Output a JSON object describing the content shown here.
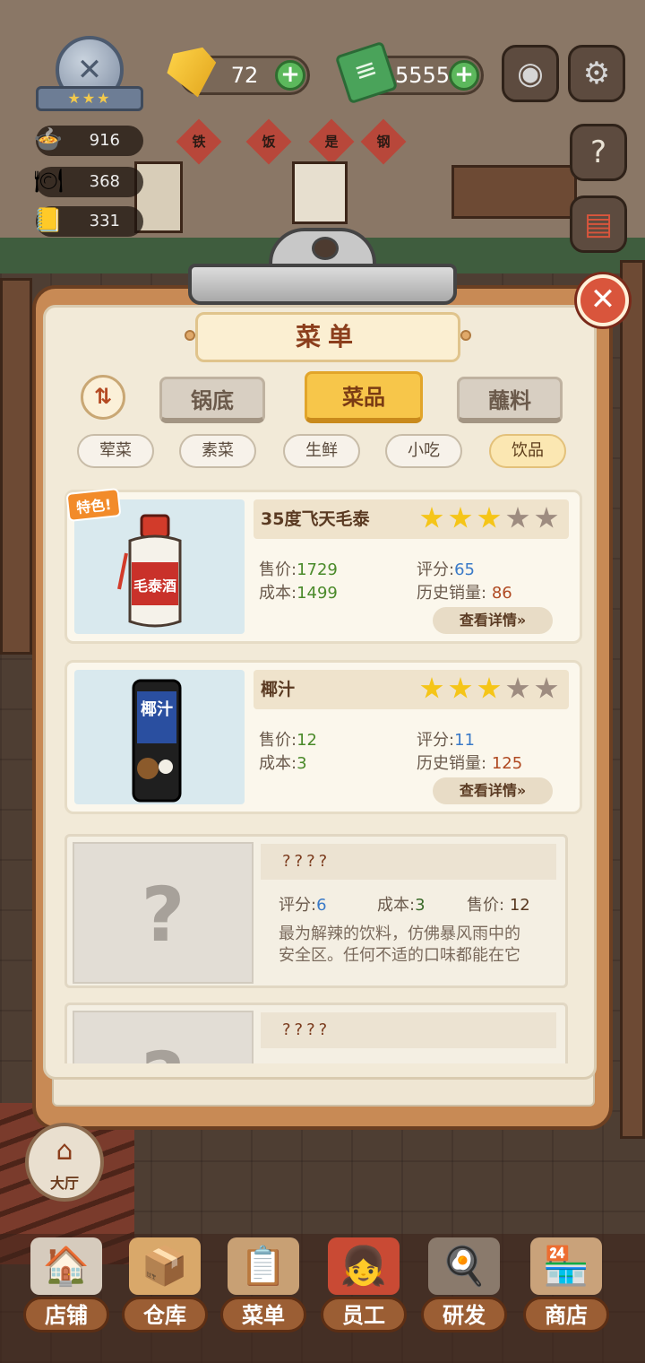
{
  "hud": {
    "rank_stars": "★★★",
    "gems": "72",
    "cash": "5555",
    "stats": [
      {
        "label": "916"
      },
      {
        "label": "368"
      },
      {
        "label": "331"
      }
    ],
    "camera_icon": "camera-icon",
    "gear_icon": "gear-icon"
  },
  "background": {
    "banner_chars": [
      "铁",
      "饭",
      "是",
      "钢"
    ]
  },
  "menu": {
    "title": "菜单",
    "close": "✕",
    "sort_icon": "⇅",
    "tabs": [
      {
        "label": "锅底",
        "active": false
      },
      {
        "label": "菜品",
        "active": true
      },
      {
        "label": "蘸料",
        "active": false
      }
    ],
    "filters": [
      {
        "label": "荤菜",
        "active": false
      },
      {
        "label": "素菜",
        "active": false
      },
      {
        "label": "生鲜",
        "active": false
      },
      {
        "label": "小吃",
        "active": false
      },
      {
        "label": "饮品",
        "active": true
      }
    ]
  },
  "items": [
    {
      "special_tag": "特色!",
      "name": "35度飞天毛泰",
      "stars": 3,
      "stars_max": 5,
      "price_label": "售价:",
      "price": "1729",
      "cost_label": "成本:",
      "cost": "1499",
      "rating_label": "评分:",
      "rating": "65",
      "sales_label": "历史销量:",
      "sales": "86",
      "detail_label": "查看详情»",
      "bottle_text": "毛泰酒"
    },
    {
      "name": "椰汁",
      "stars": 3,
      "stars_max": 5,
      "price_label": "售价:",
      "price": "12",
      "cost_label": "成本:",
      "cost": "3",
      "rating_label": "评分:",
      "rating": "11",
      "sales_label": "历史销量:",
      "sales": "125",
      "detail_label": "查看详情»",
      "can_text": "椰汁"
    }
  ],
  "locked": [
    {
      "name": "????",
      "rating_label": "评分:",
      "rating": "6",
      "cost_label": "成本:",
      "cost": "3",
      "price_label": "售价:",
      "price": "12",
      "desc_line1": "最为解辣的饮料，仿佛暴风雨中的",
      "desc_line2": "安全区。任何不适的口味都能在它",
      "placeholder": "?"
    },
    {
      "name": "????",
      "placeholder": "?"
    }
  ],
  "hall_label": "大厅",
  "nav": [
    {
      "label": "店铺",
      "icon": "shop-icon"
    },
    {
      "label": "仓库",
      "icon": "warehouse-icon"
    },
    {
      "label": "菜单",
      "icon": "menu-icon"
    },
    {
      "label": "员工",
      "icon": "staff-icon"
    },
    {
      "label": "研发",
      "icon": "research-icon"
    },
    {
      "label": "商店",
      "icon": "store-icon"
    }
  ],
  "colors": {
    "accent": "#f7c64a",
    "star_full": "#f5c518",
    "star_empty": "#9e8c80",
    "close": "#d9553c"
  }
}
